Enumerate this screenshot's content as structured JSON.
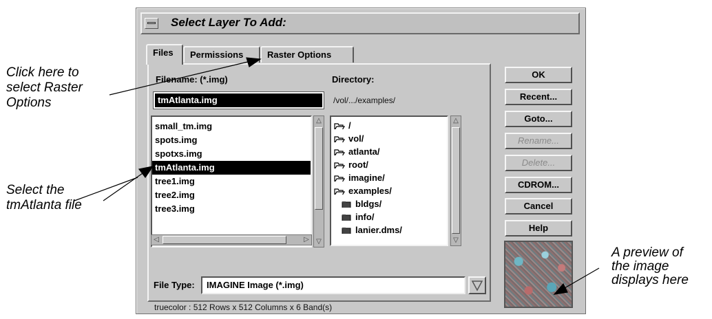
{
  "dialog": {
    "title": "Select Layer To Add:",
    "tabs": [
      "Files",
      "Permissions",
      "Raster Options"
    ],
    "filename_label": "Filename: (*.img)",
    "filename_value": "tmAtlanta.img",
    "directory_label": "Directory:",
    "directory_path": "/vol/.../examples/",
    "files": [
      "small_tm.img",
      "spots.img",
      "spotxs.img",
      "tmAtlanta.img",
      "tree1.img",
      "tree2.img",
      "tree3.img"
    ],
    "selected_file": "tmAtlanta.img",
    "directories": [
      {
        "name": "/",
        "icon": "open-folder-icon"
      },
      {
        "name": "vol/",
        "icon": "open-folder-icon"
      },
      {
        "name": "atlanta/",
        "icon": "open-folder-icon"
      },
      {
        "name": "root/",
        "icon": "open-folder-icon"
      },
      {
        "name": "imagine/",
        "icon": "open-folder-icon"
      },
      {
        "name": "examples/",
        "icon": "open-folder-icon"
      },
      {
        "name": "bldgs/",
        "icon": "closed-folder-icon"
      },
      {
        "name": "info/",
        "icon": "closed-folder-icon"
      },
      {
        "name": "lanier.dms/",
        "icon": "closed-folder-icon"
      }
    ],
    "file_type_label": "File Type:",
    "file_type_value": "IMAGINE Image (*.img)",
    "info_text": "truecolor : 512 Rows x 512 Columns x 6 Band(s)",
    "buttons": [
      {
        "label": "OK",
        "enabled": true
      },
      {
        "label": "Recent...",
        "enabled": true
      },
      {
        "label": "Goto...",
        "enabled": true
      },
      {
        "label": "Rename...",
        "enabled": false
      },
      {
        "label": "Delete...",
        "enabled": false
      },
      {
        "label": "CDROM...",
        "enabled": true
      },
      {
        "label": "Cancel",
        "enabled": true
      },
      {
        "label": "Help",
        "enabled": true
      }
    ]
  },
  "callouts": {
    "raster_options": [
      "Click here to",
      "select Raster",
      "Options"
    ],
    "select_file": [
      "Select the",
      "tmAtlanta file"
    ],
    "preview": [
      "A preview of",
      "the image",
      "displays here"
    ]
  }
}
